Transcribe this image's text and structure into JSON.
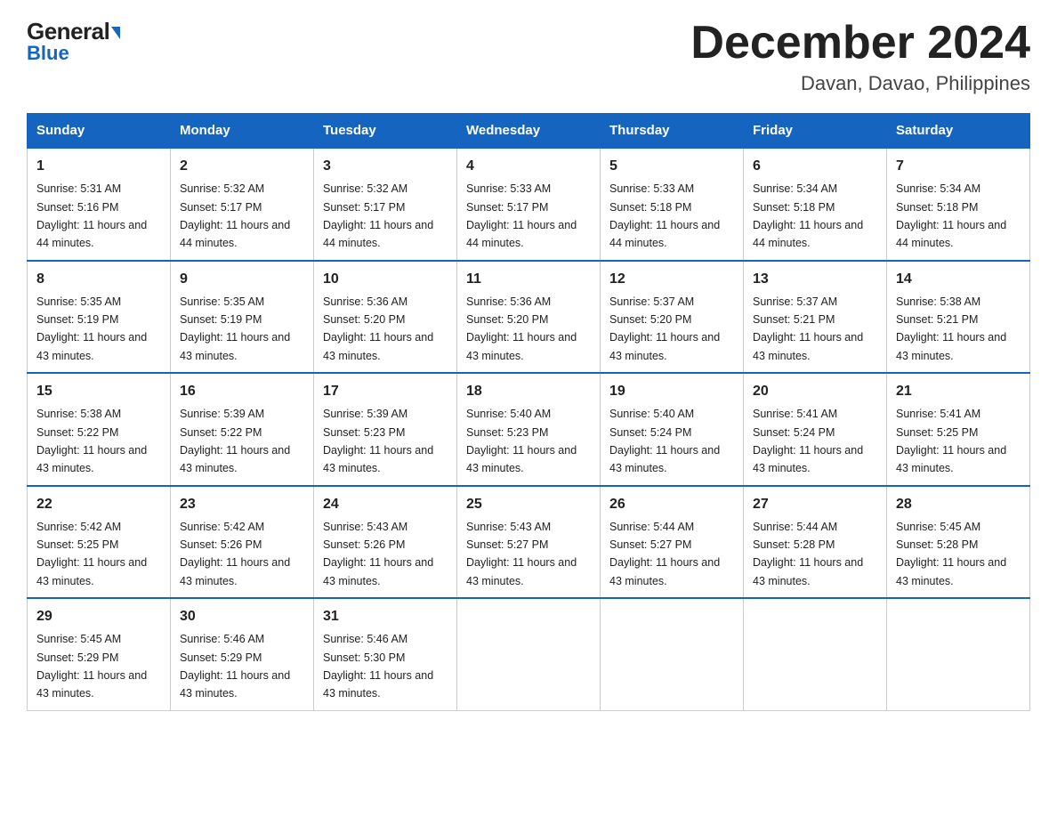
{
  "header": {
    "logo_general": "General",
    "logo_blue": "Blue",
    "title": "December 2024",
    "subtitle": "Davan, Davao, Philippines"
  },
  "days_of_week": [
    "Sunday",
    "Monday",
    "Tuesday",
    "Wednesday",
    "Thursday",
    "Friday",
    "Saturday"
  ],
  "weeks": [
    [
      {
        "day": "1",
        "sunrise": "Sunrise: 5:31 AM",
        "sunset": "Sunset: 5:16 PM",
        "daylight": "Daylight: 11 hours and 44 minutes."
      },
      {
        "day": "2",
        "sunrise": "Sunrise: 5:32 AM",
        "sunset": "Sunset: 5:17 PM",
        "daylight": "Daylight: 11 hours and 44 minutes."
      },
      {
        "day": "3",
        "sunrise": "Sunrise: 5:32 AM",
        "sunset": "Sunset: 5:17 PM",
        "daylight": "Daylight: 11 hours and 44 minutes."
      },
      {
        "day": "4",
        "sunrise": "Sunrise: 5:33 AM",
        "sunset": "Sunset: 5:17 PM",
        "daylight": "Daylight: 11 hours and 44 minutes."
      },
      {
        "day": "5",
        "sunrise": "Sunrise: 5:33 AM",
        "sunset": "Sunset: 5:18 PM",
        "daylight": "Daylight: 11 hours and 44 minutes."
      },
      {
        "day": "6",
        "sunrise": "Sunrise: 5:34 AM",
        "sunset": "Sunset: 5:18 PM",
        "daylight": "Daylight: 11 hours and 44 minutes."
      },
      {
        "day": "7",
        "sunrise": "Sunrise: 5:34 AM",
        "sunset": "Sunset: 5:18 PM",
        "daylight": "Daylight: 11 hours and 44 minutes."
      }
    ],
    [
      {
        "day": "8",
        "sunrise": "Sunrise: 5:35 AM",
        "sunset": "Sunset: 5:19 PM",
        "daylight": "Daylight: 11 hours and 43 minutes."
      },
      {
        "day": "9",
        "sunrise": "Sunrise: 5:35 AM",
        "sunset": "Sunset: 5:19 PM",
        "daylight": "Daylight: 11 hours and 43 minutes."
      },
      {
        "day": "10",
        "sunrise": "Sunrise: 5:36 AM",
        "sunset": "Sunset: 5:20 PM",
        "daylight": "Daylight: 11 hours and 43 minutes."
      },
      {
        "day": "11",
        "sunrise": "Sunrise: 5:36 AM",
        "sunset": "Sunset: 5:20 PM",
        "daylight": "Daylight: 11 hours and 43 minutes."
      },
      {
        "day": "12",
        "sunrise": "Sunrise: 5:37 AM",
        "sunset": "Sunset: 5:20 PM",
        "daylight": "Daylight: 11 hours and 43 minutes."
      },
      {
        "day": "13",
        "sunrise": "Sunrise: 5:37 AM",
        "sunset": "Sunset: 5:21 PM",
        "daylight": "Daylight: 11 hours and 43 minutes."
      },
      {
        "day": "14",
        "sunrise": "Sunrise: 5:38 AM",
        "sunset": "Sunset: 5:21 PM",
        "daylight": "Daylight: 11 hours and 43 minutes."
      }
    ],
    [
      {
        "day": "15",
        "sunrise": "Sunrise: 5:38 AM",
        "sunset": "Sunset: 5:22 PM",
        "daylight": "Daylight: 11 hours and 43 minutes."
      },
      {
        "day": "16",
        "sunrise": "Sunrise: 5:39 AM",
        "sunset": "Sunset: 5:22 PM",
        "daylight": "Daylight: 11 hours and 43 minutes."
      },
      {
        "day": "17",
        "sunrise": "Sunrise: 5:39 AM",
        "sunset": "Sunset: 5:23 PM",
        "daylight": "Daylight: 11 hours and 43 minutes."
      },
      {
        "day": "18",
        "sunrise": "Sunrise: 5:40 AM",
        "sunset": "Sunset: 5:23 PM",
        "daylight": "Daylight: 11 hours and 43 minutes."
      },
      {
        "day": "19",
        "sunrise": "Sunrise: 5:40 AM",
        "sunset": "Sunset: 5:24 PM",
        "daylight": "Daylight: 11 hours and 43 minutes."
      },
      {
        "day": "20",
        "sunrise": "Sunrise: 5:41 AM",
        "sunset": "Sunset: 5:24 PM",
        "daylight": "Daylight: 11 hours and 43 minutes."
      },
      {
        "day": "21",
        "sunrise": "Sunrise: 5:41 AM",
        "sunset": "Sunset: 5:25 PM",
        "daylight": "Daylight: 11 hours and 43 minutes."
      }
    ],
    [
      {
        "day": "22",
        "sunrise": "Sunrise: 5:42 AM",
        "sunset": "Sunset: 5:25 PM",
        "daylight": "Daylight: 11 hours and 43 minutes."
      },
      {
        "day": "23",
        "sunrise": "Sunrise: 5:42 AM",
        "sunset": "Sunset: 5:26 PM",
        "daylight": "Daylight: 11 hours and 43 minutes."
      },
      {
        "day": "24",
        "sunrise": "Sunrise: 5:43 AM",
        "sunset": "Sunset: 5:26 PM",
        "daylight": "Daylight: 11 hours and 43 minutes."
      },
      {
        "day": "25",
        "sunrise": "Sunrise: 5:43 AM",
        "sunset": "Sunset: 5:27 PM",
        "daylight": "Daylight: 11 hours and 43 minutes."
      },
      {
        "day": "26",
        "sunrise": "Sunrise: 5:44 AM",
        "sunset": "Sunset: 5:27 PM",
        "daylight": "Daylight: 11 hours and 43 minutes."
      },
      {
        "day": "27",
        "sunrise": "Sunrise: 5:44 AM",
        "sunset": "Sunset: 5:28 PM",
        "daylight": "Daylight: 11 hours and 43 minutes."
      },
      {
        "day": "28",
        "sunrise": "Sunrise: 5:45 AM",
        "sunset": "Sunset: 5:28 PM",
        "daylight": "Daylight: 11 hours and 43 minutes."
      }
    ],
    [
      {
        "day": "29",
        "sunrise": "Sunrise: 5:45 AM",
        "sunset": "Sunset: 5:29 PM",
        "daylight": "Daylight: 11 hours and 43 minutes."
      },
      {
        "day": "30",
        "sunrise": "Sunrise: 5:46 AM",
        "sunset": "Sunset: 5:29 PM",
        "daylight": "Daylight: 11 hours and 43 minutes."
      },
      {
        "day": "31",
        "sunrise": "Sunrise: 5:46 AM",
        "sunset": "Sunset: 5:30 PM",
        "daylight": "Daylight: 11 hours and 43 minutes."
      },
      null,
      null,
      null,
      null
    ]
  ]
}
